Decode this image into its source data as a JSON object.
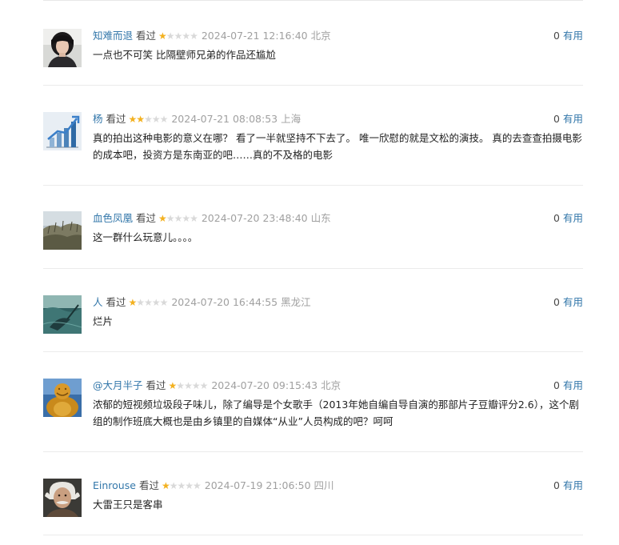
{
  "comments": [
    {
      "author": "知难而退",
      "status": "看过",
      "rating": 1,
      "time": "2024-07-21 12:16:40",
      "location": "北京",
      "votes": "0",
      "useful_label": "有用",
      "content": "一点也不可笑 比隔壁师兄弟的作品还尴尬",
      "avatar_icon": "portrait-photo-icon"
    },
    {
      "author": "杨",
      "status": "看过",
      "rating": 2,
      "time": "2024-07-21 08:08:53",
      "location": "上海",
      "votes": "0",
      "useful_label": "有用",
      "content": "真的拍出这种电影的意义在哪？ 看了一半就坚持不下去了。 唯一欣慰的就是文松的演技。 真的去查查拍摄电影的成本吧，投资方是东南亚的吧……真的不及格的电影",
      "avatar_icon": "bar-chart-icon"
    },
    {
      "author": "血色凤凰",
      "status": "看过",
      "rating": 1,
      "time": "2024-07-20 23:48:40",
      "location": "山东",
      "votes": "0",
      "useful_label": "有用",
      "content": "这一群什么玩意儿。。。。",
      "avatar_icon": "landscape-photo-icon"
    },
    {
      "author": "人",
      "status": "看过",
      "rating": 1,
      "time": "2024-07-20 16:44:55",
      "location": "黑龙江",
      "votes": "0",
      "useful_label": "有用",
      "content": "烂片",
      "avatar_icon": "ocean-photo-icon"
    },
    {
      "author": "@大月半子",
      "status": "看过",
      "rating": 1,
      "time": "2024-07-20 09:15:43",
      "location": "北京",
      "votes": "0",
      "useful_label": "有用",
      "content": "浓郁的短视频垃圾段子味儿，除了编导是个女歌手（2013年她自编自导自演的那部片子豆瓣评分2.6），这个剧组的制作班底大概也是由乡镇里的自媒体“从业”人员构成的吧？呵呵",
      "avatar_icon": "golden-buddha-icon"
    },
    {
      "author": "Einrouse",
      "status": "看过",
      "rating": 1,
      "time": "2024-07-19 21:06:50",
      "location": "四川",
      "votes": "0",
      "useful_label": "有用",
      "content": "大雷王只是客串",
      "avatar_icon": "portrait-einstein-icon"
    }
  ],
  "colors": {
    "link": "#3377aa",
    "star": "#f3b11f",
    "meta": "#a0a0a0"
  }
}
